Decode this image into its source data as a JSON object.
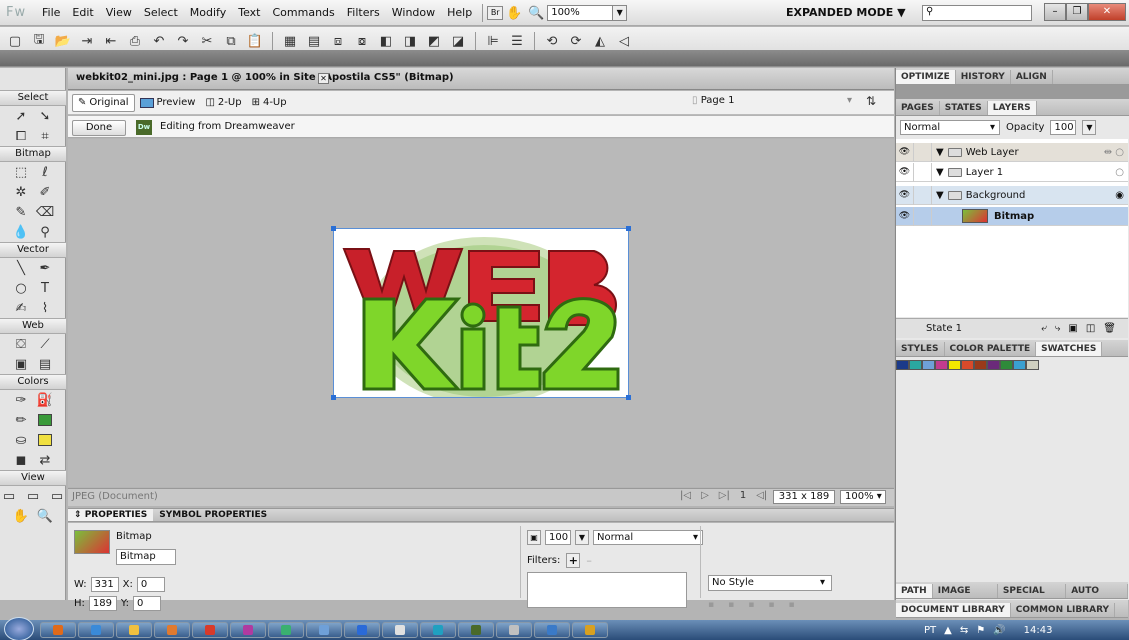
{
  "app": {
    "logo": "Fw"
  },
  "menubar": {
    "items": [
      "File",
      "Edit",
      "View",
      "Select",
      "Modify",
      "Text",
      "Commands",
      "Filters",
      "Window",
      "Help"
    ],
    "bridge_label": "Br",
    "zoom": "100%",
    "mode": "EXPANDED MODE",
    "mode_arrow": "▼",
    "search_placeholder": ""
  },
  "document": {
    "tab_title": "webkit02_mini.jpg : Page 1 @ 100% in Site \"Apostila CS5\" (Bitmap)",
    "views": {
      "original": "Original",
      "preview": "Preview",
      "two_up": "2-Up",
      "four_up": "4-Up"
    },
    "page": "Page 1",
    "done_label": "Done",
    "dw_badge": "Dw",
    "editing_text": "Editing from Dreamweaver",
    "status_left": "JPEG (Document)",
    "page_number": "1",
    "doc_size": "331 x 189",
    "zoom_level": "100%"
  },
  "tools": {
    "sections": {
      "select": "Select",
      "bitmap": "Bitmap",
      "vector": "Vector",
      "web": "Web",
      "colors": "Colors",
      "view": "View"
    }
  },
  "properties": {
    "tabs": [
      "PROPERTIES",
      "SYMBOL PROPERTIES"
    ],
    "object_type": "Bitmap",
    "object_name": "Bitmap",
    "w_label": "W:",
    "w": "331",
    "h_label": "H:",
    "h": "189",
    "x_label": "X:",
    "x": "0",
    "y_label": "Y:",
    "y": "0",
    "opacity": "100",
    "blend": "Normal",
    "filters_label": "Filters:",
    "style": "No Style"
  },
  "right_panel": {
    "top_tabs": [
      "OPTIMIZE",
      "HISTORY",
      "ALIGN"
    ],
    "sub_tabs": [
      "PAGES",
      "STATES",
      "LAYERS"
    ],
    "blend_mode": "Normal",
    "opacity_label": "Opacity",
    "opacity": "100",
    "layers": [
      {
        "name": "Web Layer",
        "bold": false
      },
      {
        "name": "Layer 1",
        "bold": false
      },
      {
        "name": "Background",
        "bold": false
      },
      {
        "name": "Bitmap",
        "bold": true
      }
    ],
    "state": "State 1",
    "lower_tabs": [
      "STYLES",
      "COLOR PALETTE",
      "SWATCHES"
    ],
    "swatch_colors": [
      "#1b3a8a",
      "#2aa7a0",
      "#6fa0d8",
      "#c23b8f",
      "#f2e600",
      "#d84a2a",
      "#9a3a1a",
      "#6b2a7a",
      "#2e8a3a",
      "#3aa0d0",
      "#d0d0c0"
    ],
    "bottom_tabs": [
      "PATH",
      "IMAGE EDITI",
      "SPECIAL CHA",
      "AUTO SHAP"
    ],
    "library_tabs": [
      "DOCUMENT LIBRARY",
      "COMMON LIBRARY"
    ]
  },
  "taskbar": {
    "lang": "PT",
    "time": "14:43",
    "task_colors": [
      "#e06a1a",
      "#3a8ad8",
      "#f0c040",
      "#e07a30",
      "#d83a2a",
      "#b03aa0",
      "#3ab070",
      "#6fa0d8",
      "#2a6ad8",
      "#e0e0e0",
      "#20a0c0",
      "#4a6a2a",
      "#c0c0c0",
      "#3a7ac8",
      "#d8a020"
    ]
  }
}
